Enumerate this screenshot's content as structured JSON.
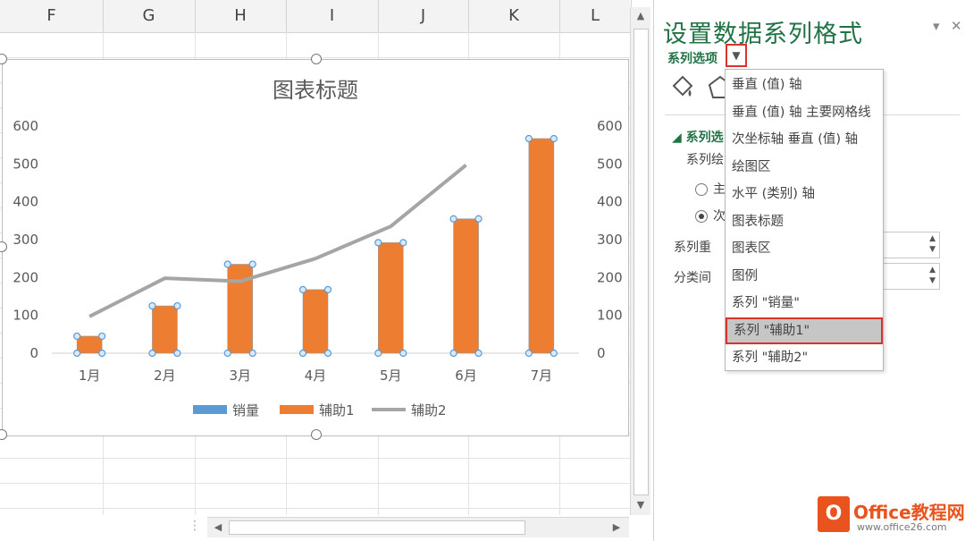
{
  "sheet": {
    "columns": [
      "F",
      "G",
      "H",
      "I",
      "J",
      "K",
      "L"
    ]
  },
  "chart_data": {
    "type": "bar",
    "title": "图表标题",
    "categories": [
      "1月",
      "2月",
      "3月",
      "4月",
      "5月",
      "6月",
      "7月"
    ],
    "series": [
      {
        "name": "销量",
        "type": "bar",
        "values": [
          0,
          0,
          0,
          0,
          0,
          0,
          0
        ],
        "color": "#5b9bd5"
      },
      {
        "name": "辅助1",
        "type": "bar",
        "values": [
          45,
          125,
          235,
          168,
          292,
          355,
          567
        ],
        "color": "#ed7d31"
      },
      {
        "name": "辅助2",
        "type": "line",
        "values": [
          97,
          198,
          190,
          250,
          335,
          497,
          null
        ],
        "color": "#a5a5a5"
      }
    ],
    "ylim": [
      0,
      600
    ],
    "y_ticks": [
      0,
      100,
      200,
      300,
      400,
      500,
      600
    ],
    "secondary_y_ticks": [
      0,
      100,
      200,
      300,
      400,
      500,
      600
    ],
    "grid": false,
    "legend": "bottom"
  },
  "pane": {
    "title": "设置数据系列格式",
    "subtitle": "系列选项",
    "dropdown_arrow": "▼",
    "pin_icon": "▾",
    "close_icon": "✕",
    "section_title": "系列选",
    "label_plot": "系列绘",
    "radio_primary": "主",
    "radio_secondary": "次",
    "label_overlap": "系列重",
    "label_gap": "分类间"
  },
  "dropdown": {
    "items": [
      "垂直 (值) 轴",
      "垂直 (值) 轴 主要网格线",
      "次坐标轴 垂直 (值) 轴",
      "绘图区",
      "水平 (类别) 轴",
      "图表标题",
      "图表区",
      "图例",
      "系列 \"销量\"",
      "系列 \"辅助1\"",
      "系列 \"辅助2\""
    ],
    "selected_index": 9
  },
  "watermark": {
    "logo": "O",
    "text": "Office教程网",
    "sub": "www.office26.com"
  },
  "colors": {
    "accent": "#217346",
    "highlight": "#d9342b"
  }
}
